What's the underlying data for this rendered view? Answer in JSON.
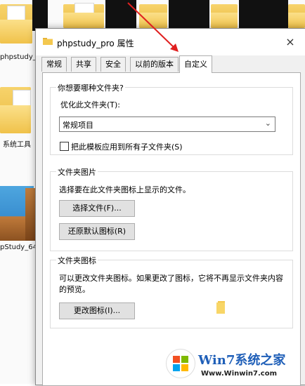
{
  "desktop": {
    "labels": [
      "phpstudy_pr",
      "系统工具",
      "pStudy_64"
    ]
  },
  "dialog": {
    "title": "phpstudy_pro 属性",
    "close_icon": "×",
    "tabs": [
      "常规",
      "共享",
      "安全",
      "以前的版本",
      "自定义"
    ],
    "active_tab": "自定义",
    "section1": {
      "title": "你想要哪种文件夹?",
      "optimize_label": "优化此文件夹(T):",
      "optimize_value": "常规项目",
      "apply_subfolders_label": "把此模板应用到所有子文件夹(S)",
      "apply_subfolders_checked": false
    },
    "section2": {
      "title": "文件夹图片",
      "description": "选择要在此文件夹图标上显示的文件。",
      "choose_file_button": "选择文件(F)...",
      "restore_default_button": "还原默认图标(R)"
    },
    "section3": {
      "title": "文件夹图标",
      "description_line1": "可以更改文件夹图标。如果更改了图标，它将不再显示文件夹内容",
      "description_line2": "的预览。",
      "change_icon_button": "更改图标(I)..."
    }
  },
  "watermark": {
    "title": "Win7系统之家",
    "url": "Www.Winwin7.com"
  },
  "colors": {
    "arrow": "#e02020",
    "folder": "#f0c24a",
    "watermark_blue": "#1f5fb8"
  }
}
